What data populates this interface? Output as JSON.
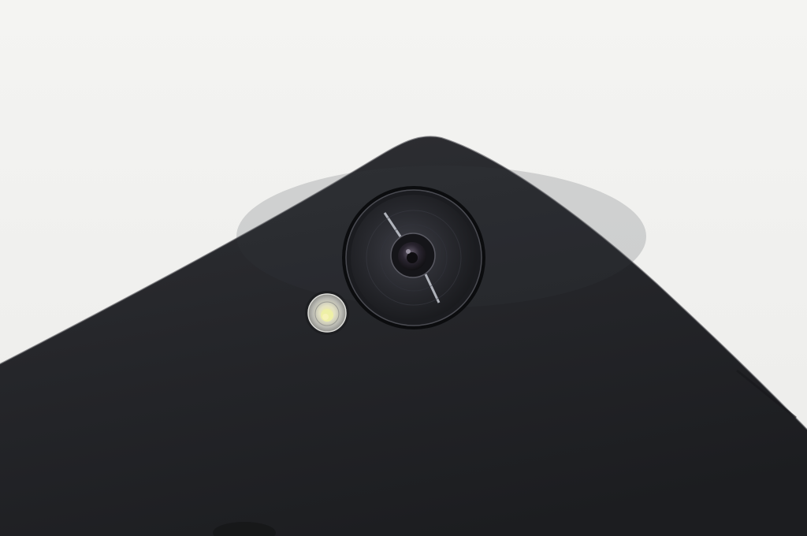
{
  "scene": {
    "subject": "phone-back-camera-closeup",
    "colors": {
      "background": "#f2f2f0",
      "phone_body": "#232427",
      "phone_highlight": "#34353a",
      "lens_ring": "#0e0f11",
      "lens_glass": "#2c2d33",
      "flash_ring": "#c9c9c4",
      "flash_center": "#e8e39a"
    },
    "icons": [
      "camera-lens-icon",
      "flash-icon"
    ]
  }
}
